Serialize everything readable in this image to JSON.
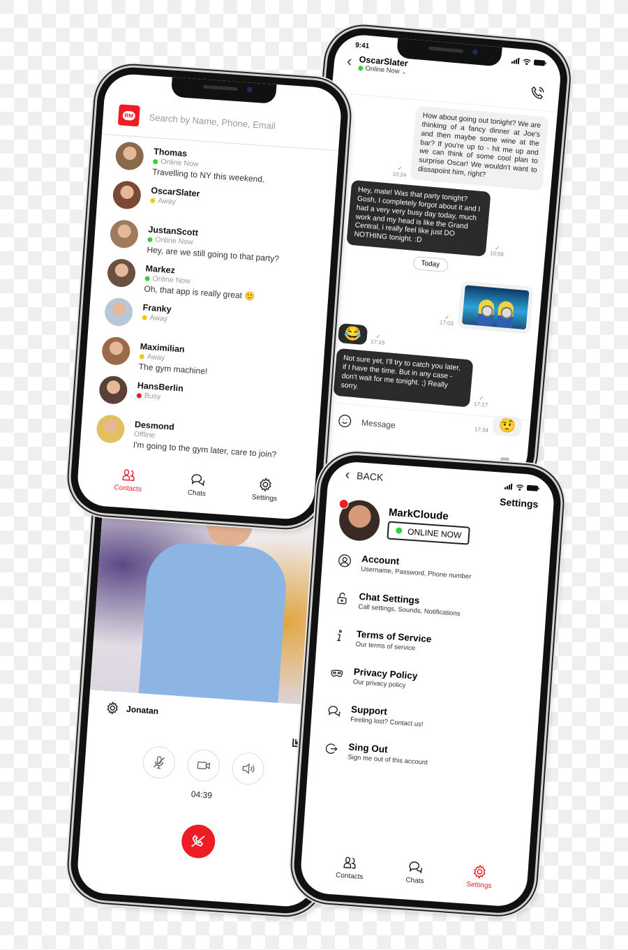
{
  "colors": {
    "accent": "#ee1c25",
    "online": "#2fd52f",
    "away": "#f7c600",
    "busy": "#ee1c25"
  },
  "contacts_screen": {
    "logo_text": "RM",
    "search_placeholder": "Search by Name, Phone, Email",
    "contacts": [
      {
        "name": "Thomas",
        "status": "Online Now",
        "status_type": "online",
        "message": "Travelling to NY this weekend."
      },
      {
        "name": "OscarSlater",
        "status": "Away",
        "status_type": "away",
        "message": ""
      },
      {
        "name": "JustanScott",
        "status": "Online Now",
        "status_type": "online",
        "message": "Hey, are we still going to that party?"
      },
      {
        "name": "Markez",
        "status": "Online Now",
        "status_type": "online",
        "message": "Oh, that app is really great 🙂"
      },
      {
        "name": "Franky",
        "status": "Away",
        "status_type": "away",
        "message": ""
      },
      {
        "name": "Maximilian",
        "status": "Away",
        "status_type": "away",
        "message": "The gym machine!"
      },
      {
        "name": "HansBerlin",
        "status": "Busy",
        "status_type": "busy",
        "message": ""
      },
      {
        "name": "Desmond",
        "status": "Offline",
        "status_type": "offline",
        "message": "I'm going to the gym later, care to join?"
      }
    ],
    "tabs": [
      {
        "label": "Contacts",
        "icon": "contacts-icon",
        "active": true
      },
      {
        "label": "Chats",
        "icon": "chats-icon",
        "active": false
      },
      {
        "label": "Settings",
        "icon": "settings-icon",
        "active": false
      }
    ]
  },
  "chat_screen": {
    "status_time": "9:41",
    "contact_name": "OscarSlater",
    "contact_status": "Online Now",
    "messages": [
      {
        "dir": "out",
        "text": "How about going out tonight? We are thinking of a fancy dinner at Joe's and then maybe some wine at the bar? If you're up to - hit me up and we can think of some cool plan to surprise Oscar! We wouldn't want to dissapoint him, right?",
        "time": "10:24"
      },
      {
        "dir": "in",
        "text": "Hey, mate! Was that party tonight? Gosh, I completely forgot about it and I had a very very busy day today, much work and my head is like the Grand Central, i really feel like just DO NOTHING tonight. :D",
        "time": "10:58"
      },
      {
        "dir": "out",
        "type": "image",
        "alt": "minions-image",
        "time": "17:03"
      },
      {
        "dir": "in",
        "type": "emoji",
        "text": "😂",
        "time": "17:15"
      },
      {
        "dir": "in",
        "text": "Not sure yet, I'll try to catch you later, if I have the time. But in any case - don't wait for me tonight. ;) Really sorry.",
        "time": "17:17"
      },
      {
        "dir": "out",
        "type": "emoji",
        "text": "🤨",
        "time": "17:34"
      }
    ],
    "date_separator": "Today",
    "message_placeholder": "Message"
  },
  "call_screen": {
    "caller_name": "Jonatan",
    "timer": "04:39"
  },
  "settings_screen": {
    "back_label": "BACK",
    "title": "Settings",
    "profile_name": "MarkCloude",
    "profile_status": "ONLINE NOW",
    "items": [
      {
        "title": "Account",
        "subtitle": "Username, Password, Phone number",
        "icon": "user-icon"
      },
      {
        "title": "Chat Settings",
        "subtitle": "Call settings, Sounds, Notifications",
        "icon": "lock-icon"
      },
      {
        "title": "Terms of Service",
        "subtitle": "Our terms of service",
        "icon": "info-icon"
      },
      {
        "title": "Privacy Policy",
        "subtitle": "Our privacy policy",
        "icon": "mask-icon"
      },
      {
        "title": "Support",
        "subtitle": "Feeling lost? Contact us!",
        "icon": "support-icon"
      },
      {
        "title": "Sing Out",
        "subtitle": "Sign me out of this account",
        "icon": "sign-out-icon"
      }
    ],
    "tabs": [
      {
        "label": "Contacts",
        "icon": "contacts-icon",
        "active": false
      },
      {
        "label": "Chats",
        "icon": "chats-icon",
        "active": false
      },
      {
        "label": "Settings",
        "icon": "settings-icon",
        "active": true
      }
    ]
  }
}
